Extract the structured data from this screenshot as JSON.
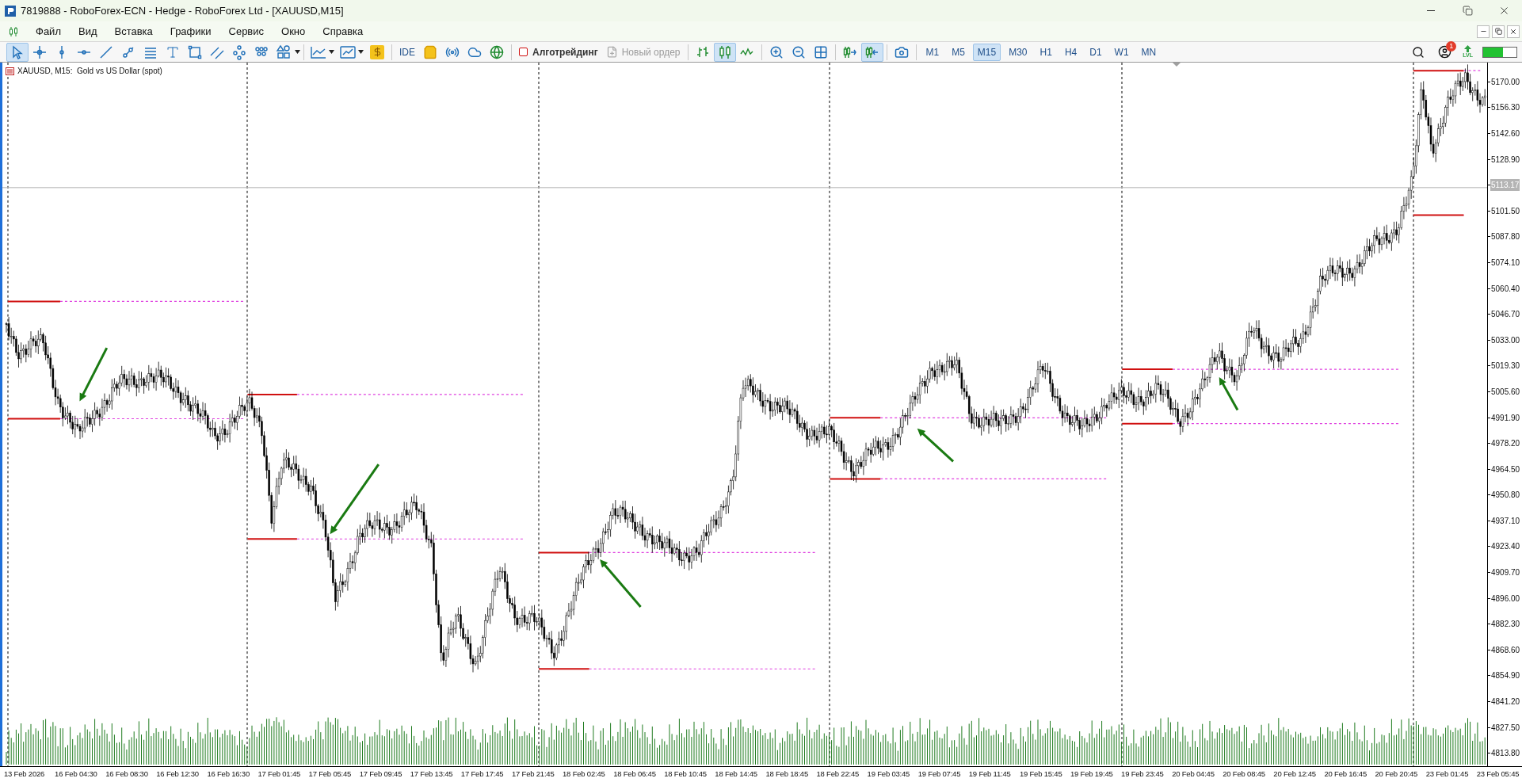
{
  "window": {
    "title": "7819888 - RoboForex-ECN - Hedge - RoboForex Ltd - [XAUUSD,M15]"
  },
  "menu": [
    "Файл",
    "Вид",
    "Вставка",
    "Графики",
    "Сервис",
    "Окно",
    "Справка"
  ],
  "toolbar": {
    "tools": [
      {
        "kind": "cursor",
        "selected": true
      },
      {
        "kind": "crosshair",
        "selected": false
      },
      {
        "kind": "vline",
        "selected": false
      },
      {
        "kind": "hline",
        "selected": false
      },
      {
        "kind": "trendline",
        "selected": false
      },
      {
        "kind": "ray",
        "selected": false
      },
      {
        "kind": "channel",
        "selected": false
      },
      {
        "kind": "text",
        "selected": false
      },
      {
        "kind": "rectangle",
        "selected": false
      },
      {
        "kind": "parallel",
        "selected": false
      },
      {
        "kind": "network",
        "selected": false
      },
      {
        "kind": "dots",
        "selected": false
      },
      {
        "kind": "shapes",
        "selected": false
      }
    ],
    "ide": "IDE",
    "algo": {
      "label": "Алготрейдинг",
      "on": false
    },
    "new_order": {
      "label": "Новый ордер",
      "disabled": true
    },
    "chart_types": [
      {
        "kind": "bars",
        "selected": false
      },
      {
        "kind": "candles",
        "selected": true
      },
      {
        "kind": "line",
        "selected": false
      }
    ],
    "scroll": [
      {
        "kind": "autoscroll",
        "selected": false
      },
      {
        "kind": "shift",
        "selected": true
      }
    ],
    "timeframes": [
      {
        "label": "M1",
        "selected": false
      },
      {
        "label": "M5",
        "selected": false
      },
      {
        "label": "M15",
        "selected": true
      },
      {
        "label": "M30",
        "selected": false
      },
      {
        "label": "H1",
        "selected": false
      },
      {
        "label": "H4",
        "selected": false
      },
      {
        "label": "D1",
        "selected": false
      },
      {
        "label": "W1",
        "selected": false
      },
      {
        "label": "MN",
        "selected": false
      }
    ],
    "notifications": "1",
    "lvl": "LVL"
  },
  "chart": {
    "title": "XAUUSD, M15:  Gold vs US Dollar (spot)",
    "price_axis": [
      {
        "kind": "tick",
        "label": "5170.00"
      },
      {
        "kind": "tick",
        "label": "5156.30"
      },
      {
        "kind": "tick",
        "label": "5142.60"
      },
      {
        "kind": "tick",
        "label": "5128.90"
      },
      {
        "kind": "current",
        "label": "5113.17"
      },
      {
        "kind": "tick",
        "label": "5101.50"
      },
      {
        "kind": "tick",
        "label": "5087.80"
      },
      {
        "kind": "tick",
        "label": "5074.10"
      },
      {
        "kind": "tick",
        "label": "5060.40"
      },
      {
        "kind": "tick",
        "label": "5046.70"
      },
      {
        "kind": "tick",
        "label": "5033.00"
      },
      {
        "kind": "tick",
        "label": "5019.30"
      },
      {
        "kind": "tick",
        "label": "5005.60"
      },
      {
        "kind": "tick",
        "label": "4991.90"
      },
      {
        "kind": "tick",
        "label": "4978.20"
      },
      {
        "kind": "tick",
        "label": "4964.50"
      },
      {
        "kind": "tick",
        "label": "4950.80"
      },
      {
        "kind": "tick",
        "label": "4937.10"
      },
      {
        "kind": "tick",
        "label": "4923.40"
      },
      {
        "kind": "tick",
        "label": "4909.70"
      },
      {
        "kind": "tick",
        "label": "4896.00"
      },
      {
        "kind": "tick",
        "label": "4882.30"
      },
      {
        "kind": "tick",
        "label": "4868.60"
      },
      {
        "kind": "tick",
        "label": "4854.90"
      },
      {
        "kind": "tick",
        "label": "4841.20"
      },
      {
        "kind": "tick",
        "label": "4827.50"
      },
      {
        "kind": "tick",
        "label": "4813.80"
      }
    ],
    "time_axis": [
      "13 Feb 2026",
      "16 Feb 04:30",
      "16 Feb 08:30",
      "16 Feb 12:30",
      "16 Feb 16:30",
      "17 Feb 01:45",
      "17 Feb 05:45",
      "17 Feb 09:45",
      "17 Feb 13:45",
      "17 Feb 17:45",
      "17 Feb 21:45",
      "18 Feb 02:45",
      "18 Feb 06:45",
      "18 Feb 10:45",
      "18 Feb 14:45",
      "18 Feb 18:45",
      "18 Feb 22:45",
      "19 Feb 03:45",
      "19 Feb 07:45",
      "19 Feb 11:45",
      "19 Feb 15:45",
      "19 Feb 19:45",
      "19 Feb 23:45",
      "20 Feb 04:45",
      "20 Feb 08:45",
      "20 Feb 12:45",
      "20 Feb 16:45",
      "20 Feb 20:45",
      "23 Feb 01:45",
      "23 Feb 05:45"
    ]
  }
}
